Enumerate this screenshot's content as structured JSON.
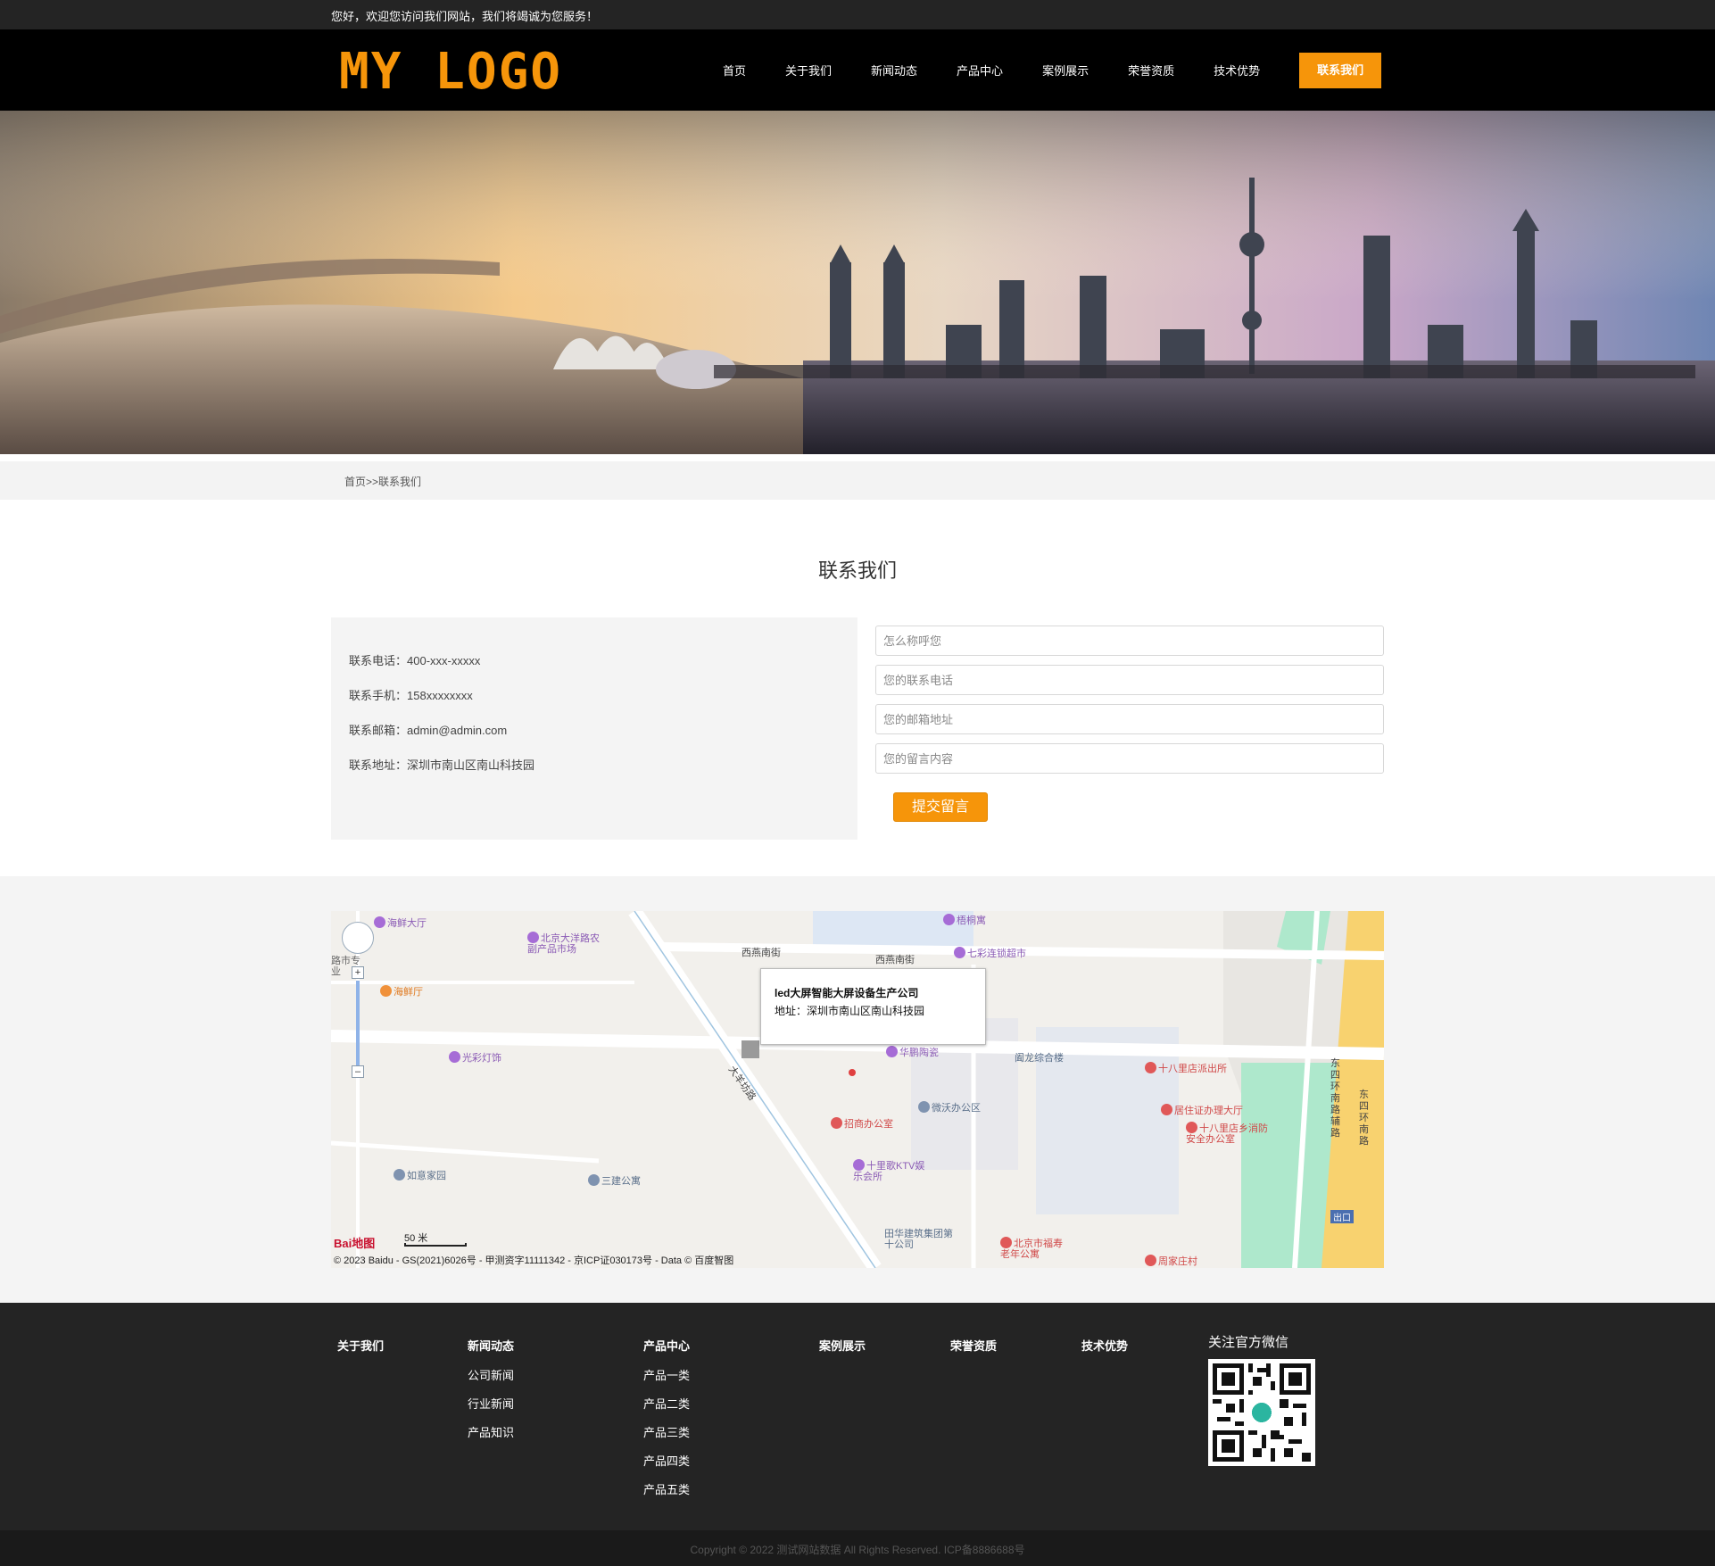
{
  "topbar": {
    "welcome": "您好，欢迎您访问我们网站，我们将竭诚为您服务！"
  },
  "header": {
    "logo_text": "MY LOGO",
    "nav": [
      {
        "label": "首页"
      },
      {
        "label": "关于我们"
      },
      {
        "label": "新闻动态"
      },
      {
        "label": "产品中心"
      },
      {
        "label": "案例展示"
      },
      {
        "label": "荣誉资质"
      },
      {
        "label": "技术优势"
      },
      {
        "label": "联系我们"
      }
    ],
    "active_color": "#f6950a"
  },
  "breadcrumb": {
    "home": "首页",
    "sep": ">>",
    "current": "联系我们"
  },
  "contact": {
    "title": "联系我们",
    "rows": [
      {
        "label": "联系电话：",
        "value": "400-xxx-xxxxx"
      },
      {
        "label": "联系手机：",
        "value": "158xxxxxxxx"
      },
      {
        "label": "联系邮箱：",
        "value": "admin@admin.com"
      },
      {
        "label": "联系地址：",
        "value": "深圳市南山区南山科技园"
      }
    ],
    "form": {
      "name_placeholder": "怎么称呼您",
      "phone_placeholder": "您的联系电话",
      "email_placeholder": "您的邮箱地址",
      "message_placeholder": "您的留言内容",
      "submit_label": "提交留言"
    }
  },
  "map": {
    "popup_title": "led大屏智能大屏设备生产公司",
    "popup_address": "地址：深圳市南山区南山科技园",
    "scale": "50 米",
    "baidu_logo": "Bai地图",
    "copyright": "© 2023 Baidu - GS(2021)6026号 - 甲测资字11111342 - 京ICP证030173号 - Data © 百度智图",
    "streets": [
      "西燕南街",
      "西燕南街",
      "大羊坊路",
      "东四环南路辅路",
      "东四环南路"
    ],
    "pois": [
      "海鲜大厅",
      "北京大洋路农副产品市场",
      "海鲜厅",
      "路市专业",
      "光彩灯饰",
      "梧桐寓",
      "七彩连锁超市",
      "华鹏陶瓷",
      "阖龙综合楼",
      "十八里店派出所",
      "微沃办公区",
      "居住证办理大厅",
      "十八里店乡消防安全办公室",
      "招商办公室",
      "十里歌KTV娱乐会所",
      "如意家园",
      "三建公寓",
      "田华建筑集团第十公司",
      "北京市福寿老年公寓",
      "周家庄村",
      "出口"
    ]
  },
  "footer": {
    "columns": [
      {
        "title": "关于我们",
        "links": []
      },
      {
        "title": "新闻动态",
        "links": [
          "公司新闻",
          "行业新闻",
          "产品知识"
        ]
      },
      {
        "title": "产品中心",
        "links": [
          "产品一类",
          "产品二类",
          "产品三类",
          "产品四类",
          "产品五类"
        ]
      },
      {
        "title": "案例展示",
        "links": []
      },
      {
        "title": "荣誉资质",
        "links": []
      },
      {
        "title": "技术优势",
        "links": []
      }
    ],
    "wechat_title": "关注官方微信",
    "copyright": "Copyright © 2022 测试网站数据 All Rights Reserved.    ICP备8886688号"
  }
}
